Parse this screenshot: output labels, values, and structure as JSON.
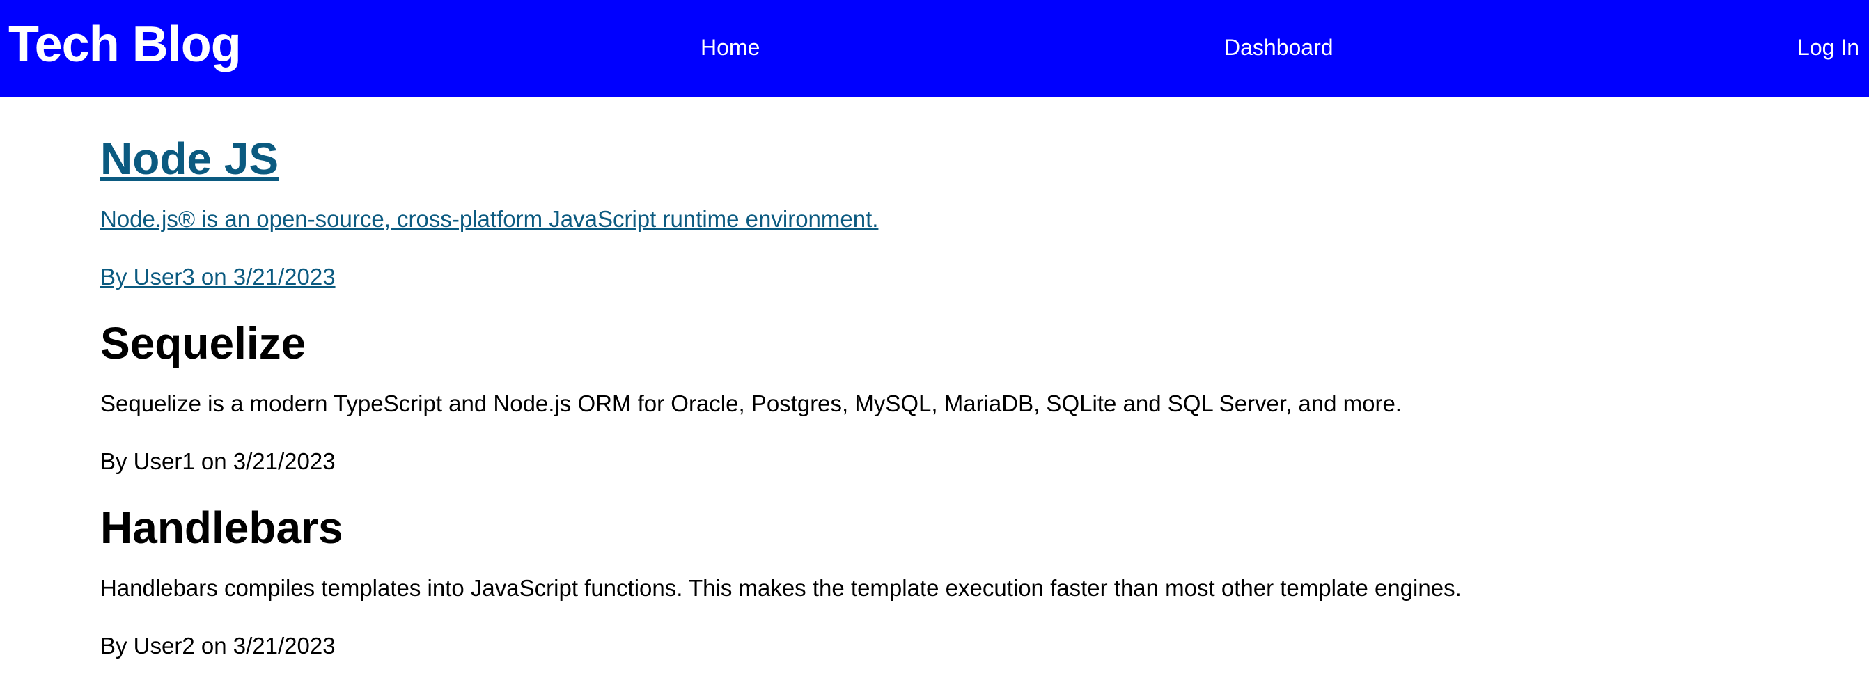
{
  "header": {
    "title": "Tech Blog",
    "nav": {
      "home": "Home",
      "dashboard": "Dashboard",
      "login": "Log In"
    },
    "background": "#0000ff"
  },
  "posts": [
    {
      "title": "Node JS",
      "description": "Node.js® is an open-source, cross-platform JavaScript runtime environment.",
      "byline": "By User3 on 3/21/2023"
    },
    {
      "title": "Sequelize",
      "description": "Sequelize is a modern TypeScript and Node.js ORM for Oracle, Postgres, MySQL, MariaDB, SQLite and SQL Server, and more.",
      "byline": "By User1 on 3/21/2023"
    },
    {
      "title": "Handlebars",
      "description": "Handlebars compiles templates into JavaScript functions. This makes the template execution faster than most other template engines.",
      "byline": "By User2 on 3/21/2023"
    }
  ],
  "colors": {
    "link": "#0b5a80"
  }
}
